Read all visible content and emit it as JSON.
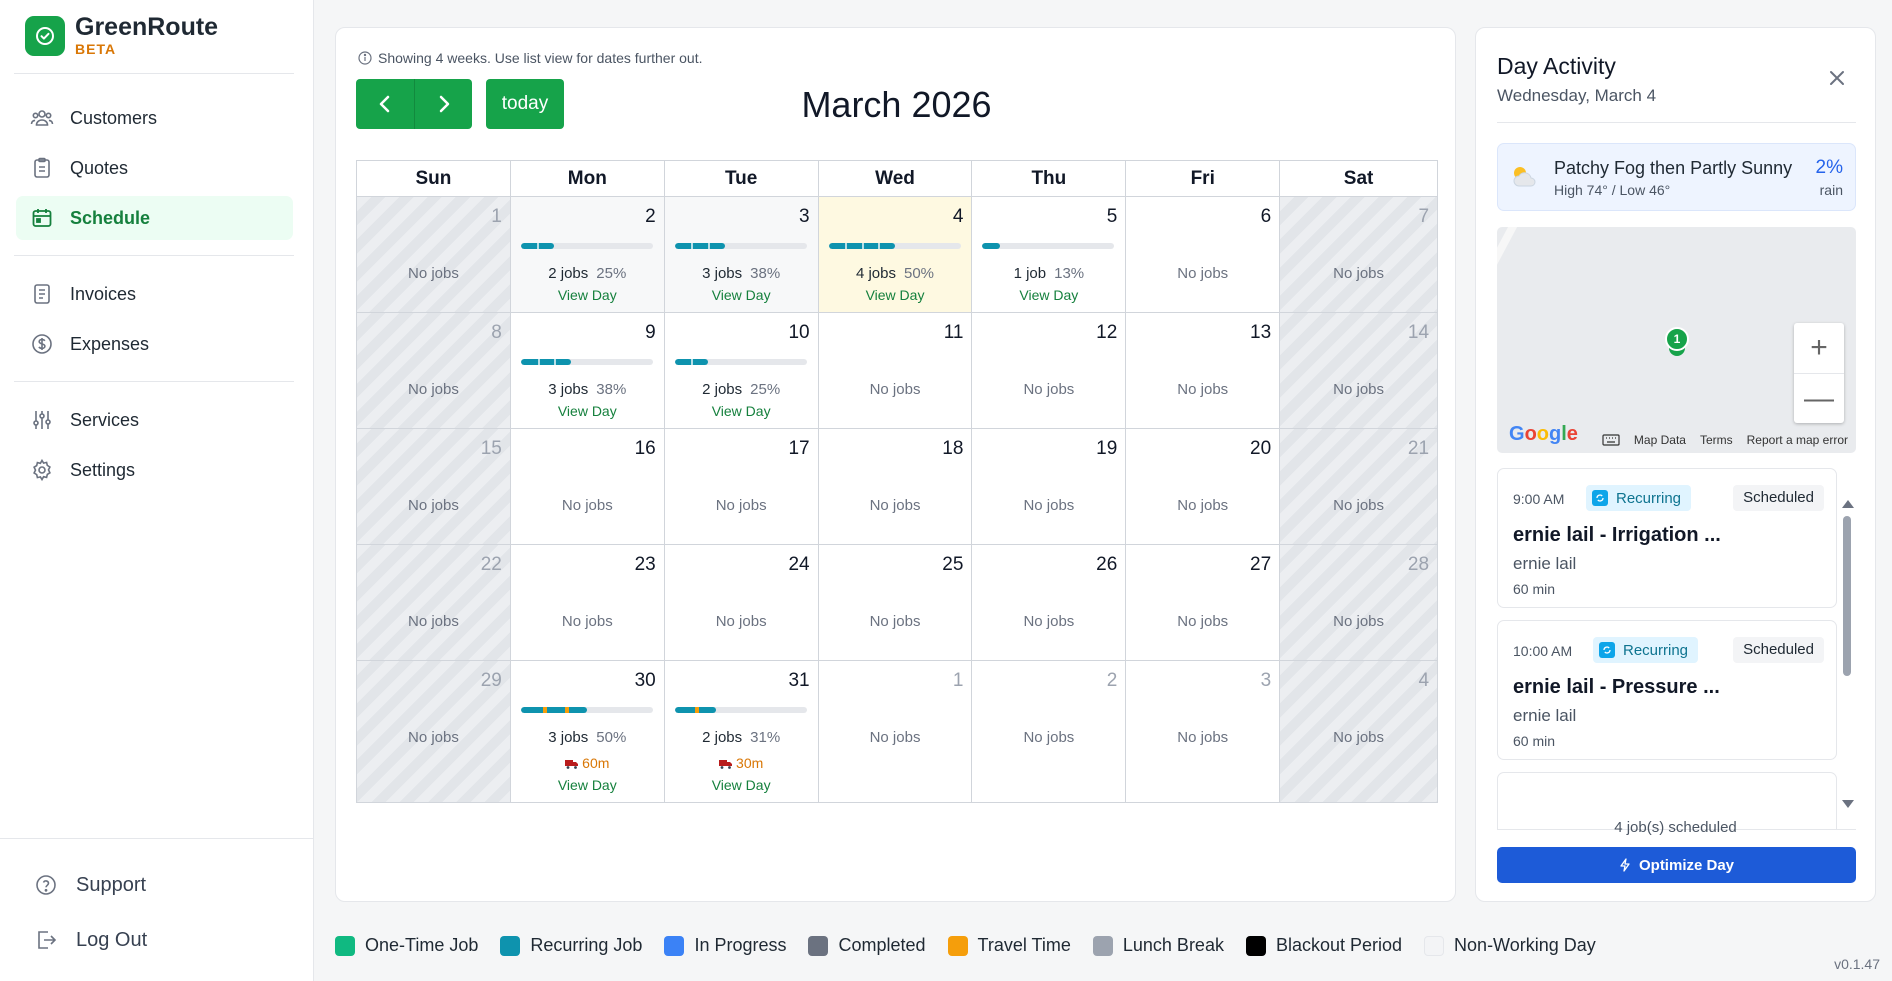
{
  "brand": {
    "name": "GreenRoute",
    "badge": "BETA"
  },
  "nav": {
    "items": [
      {
        "label": "Customers",
        "icon": "users-icon"
      },
      {
        "label": "Quotes",
        "icon": "clipboard-icon"
      },
      {
        "label": "Schedule",
        "icon": "calendar-icon",
        "active": true
      },
      {
        "label": "Invoices",
        "icon": "invoice-icon"
      },
      {
        "label": "Expenses",
        "icon": "dollar-icon"
      },
      {
        "label": "Services",
        "icon": "sliders-icon"
      },
      {
        "label": "Settings",
        "icon": "gear-icon"
      }
    ],
    "support": "Support",
    "logout": "Log Out"
  },
  "calendar": {
    "note": "Showing 4 weeks. Use list view for dates further out.",
    "today_label": "today",
    "month_title": "March 2026",
    "weekdays": [
      "Sun",
      "Mon",
      "Tue",
      "Wed",
      "Thu",
      "Fri",
      "Sat"
    ],
    "no_jobs": "No jobs",
    "view_day": "View Day",
    "weeks": [
      [
        {
          "day": "1",
          "type": "weekend"
        },
        {
          "day": "2",
          "type": "past",
          "jobs": "2 jobs",
          "pct": "25%",
          "fill": 0.25
        },
        {
          "day": "3",
          "type": "past",
          "jobs": "3 jobs",
          "pct": "38%",
          "fill": 0.38
        },
        {
          "day": "4",
          "type": "today",
          "jobs": "4 jobs",
          "pct": "50%",
          "fill": 0.5
        },
        {
          "day": "5",
          "type": "normal",
          "jobs": "1 job",
          "pct": "13%",
          "fill": 0.13
        },
        {
          "day": "6",
          "type": "normal"
        },
        {
          "day": "7",
          "type": "weekend"
        }
      ],
      [
        {
          "day": "8",
          "type": "weekend"
        },
        {
          "day": "9",
          "type": "normal",
          "jobs": "3 jobs",
          "pct": "38%",
          "fill": 0.38
        },
        {
          "day": "10",
          "type": "normal",
          "jobs": "2 jobs",
          "pct": "25%",
          "fill": 0.25
        },
        {
          "day": "11",
          "type": "normal"
        },
        {
          "day": "12",
          "type": "normal"
        },
        {
          "day": "13",
          "type": "normal"
        },
        {
          "day": "14",
          "type": "weekend"
        }
      ],
      [
        {
          "day": "15",
          "type": "weekend"
        },
        {
          "day": "16",
          "type": "normal"
        },
        {
          "day": "17",
          "type": "normal"
        },
        {
          "day": "18",
          "type": "normal"
        },
        {
          "day": "19",
          "type": "normal"
        },
        {
          "day": "20",
          "type": "normal"
        },
        {
          "day": "21",
          "type": "weekend"
        }
      ],
      [
        {
          "day": "22",
          "type": "weekend"
        },
        {
          "day": "23",
          "type": "normal"
        },
        {
          "day": "24",
          "type": "normal"
        },
        {
          "day": "25",
          "type": "normal"
        },
        {
          "day": "26",
          "type": "normal"
        },
        {
          "day": "27",
          "type": "normal"
        },
        {
          "day": "28",
          "type": "weekend"
        }
      ],
      [
        {
          "day": "29",
          "type": "weekend"
        },
        {
          "day": "30",
          "type": "normal",
          "jobs": "3 jobs",
          "pct": "50%",
          "fill": 0.5,
          "travel": "60m",
          "travel_marks": 2
        },
        {
          "day": "31",
          "type": "normal",
          "jobs": "2 jobs",
          "pct": "31%",
          "fill": 0.31,
          "travel": "30m",
          "travel_marks": 1
        },
        {
          "day": "1",
          "type": "other"
        },
        {
          "day": "2",
          "type": "other"
        },
        {
          "day": "3",
          "type": "other"
        },
        {
          "day": "4",
          "type": "weekend"
        }
      ]
    ]
  },
  "legend": [
    {
      "label": "One-Time Job",
      "color": "#10b981"
    },
    {
      "label": "Recurring Job",
      "color": "#0e93ae"
    },
    {
      "label": "In Progress",
      "color": "#3b82f6"
    },
    {
      "label": "Completed",
      "color": "#6b7280"
    },
    {
      "label": "Travel Time",
      "color": "#f59e0b"
    },
    {
      "label": "Lunch Break",
      "color": "#9ca3af"
    },
    {
      "label": "Blackout Period",
      "color": "#000000"
    },
    {
      "label": "Non-Working Day",
      "color": "#f3f4f6"
    }
  ],
  "version": "v0.1.47",
  "panel": {
    "title": "Day Activity",
    "subtitle": "Wednesday, March 4",
    "weather": {
      "icon": "partly-cloudy-icon",
      "summary": "Patchy Fog then Partly Sunny",
      "temps": "High 74° / Low 46°",
      "rain_pct": "2%",
      "rain_label": "rain"
    },
    "map": {
      "pin_label": "1",
      "zoom_in": "+",
      "zoom_out": "—",
      "logo": "Google",
      "attribution": [
        "Map Data",
        "Terms",
        "Report a map error"
      ]
    },
    "jobs": [
      {
        "time": "9:00 AM",
        "tag": "Recurring",
        "status": "Scheduled",
        "title": "ernie lail - Irrigation ...",
        "customer": "ernie lail",
        "duration": "60 min"
      },
      {
        "time": "10:00 AM",
        "tag": "Recurring",
        "status": "Scheduled",
        "title": "ernie lail - Pressure ...",
        "customer": "ernie lail",
        "duration": "60 min"
      }
    ],
    "scheduled_count": "4 job(s) scheduled",
    "optimize_label": "Optimize Day"
  }
}
